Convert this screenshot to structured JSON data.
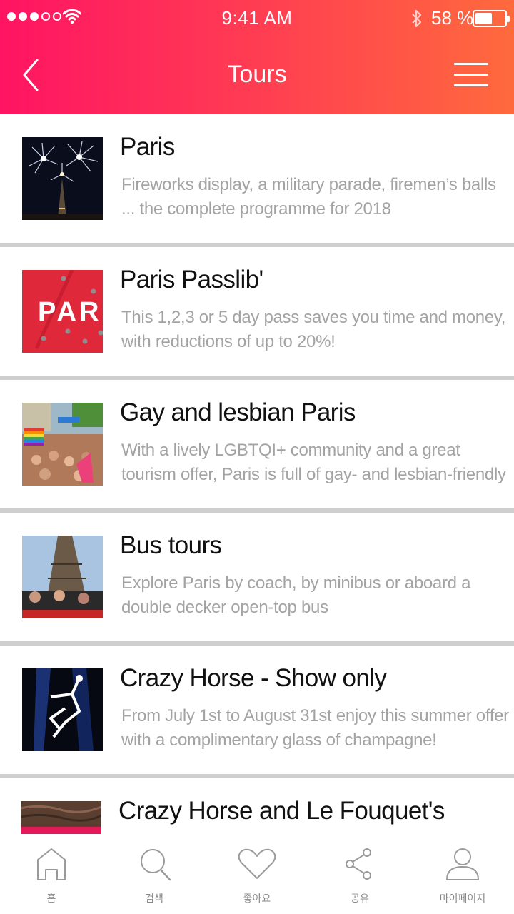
{
  "status_bar": {
    "time": "9:41 AM",
    "battery_percent": "58 %",
    "battery_level": 0.58,
    "signal_icon": "signal-dots-icon",
    "wifi_icon": "wifi-icon",
    "bluetooth_icon": "bluetooth-icon"
  },
  "nav": {
    "title": "Tours",
    "back_icon": "chevron-left-icon",
    "menu_icon": "hamburger-menu-icon"
  },
  "colors": {
    "header_gradient_start": "#ff1463",
    "header_gradient_end": "#ff6a3d",
    "title_text": "#111111",
    "description_text": "#a3a3a3",
    "separator": "#cfcfcf"
  },
  "items": [
    {
      "title": "Paris",
      "description": "Fireworks display, a military parade, firemen’s balls ... the complete programme for 2018"
    },
    {
      "title": "Paris Passlib'",
      "description": "This 1,2,3 or 5 day pass saves you time and money, with reductions of up to 20%!",
      "thumb_text": "PAR"
    },
    {
      "title": "Gay and lesbian Paris",
      "description": "With a lively LGBTQI+ community and a great tourism offer, Paris is full of gay- and lesbian-friendly"
    },
    {
      "title": "Bus tours",
      "description": "Explore Paris by coach, by minibus or aboard a double decker open-top bus"
    },
    {
      "title": "Crazy Horse - Show only",
      "description": "From July 1st to August 31st enjoy this summer offer with a complimentary glass of champagne!"
    },
    {
      "title": "Crazy Horse and Le Fouquet's",
      "description": ""
    }
  ],
  "tabbar": [
    {
      "label": "홈",
      "icon": "home-icon"
    },
    {
      "label": "검색",
      "icon": "search-icon"
    },
    {
      "label": "좋아요",
      "icon": "heart-icon"
    },
    {
      "label": "공유",
      "icon": "share-icon"
    },
    {
      "label": "마이페이지",
      "icon": "user-icon"
    }
  ]
}
